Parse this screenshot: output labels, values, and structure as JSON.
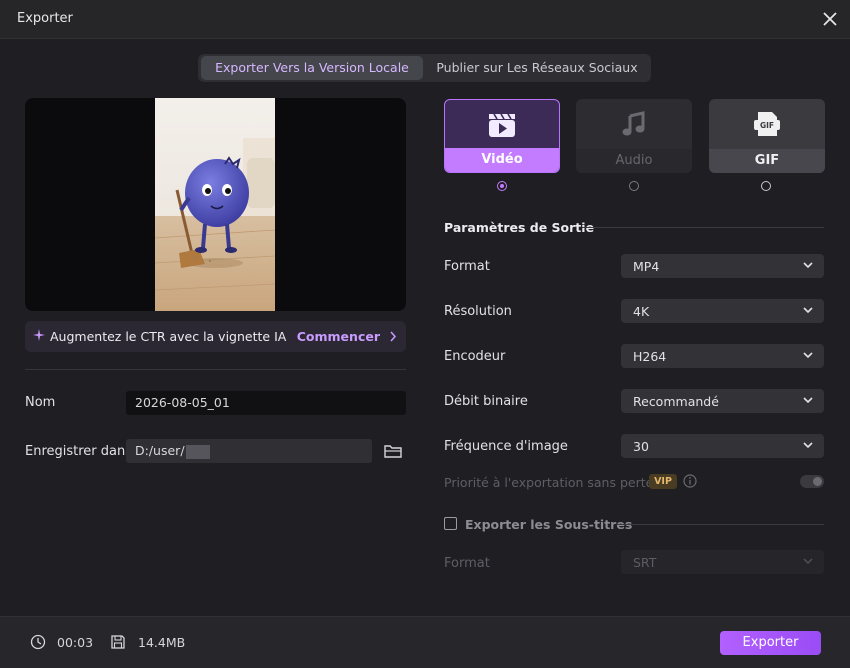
{
  "window": {
    "title": "Exporter"
  },
  "tabs": [
    {
      "label": "Exporter Vers la Version Locale",
      "active": true
    },
    {
      "label": "Publier sur Les Réseaux Sociaux",
      "active": false
    }
  ],
  "banner": {
    "text": "Augmentez le CTR avec la vignette IA",
    "action": "Commencer"
  },
  "file": {
    "name_label": "Nom",
    "name_value": "2026-08-05_01",
    "save_label": "Enregistrer dans",
    "save_path": "D:/user/"
  },
  "types": [
    {
      "label": "Vidéo",
      "icon": "video-clapper-icon",
      "selected": true
    },
    {
      "label": "Audio",
      "icon": "music-note-icon",
      "selected": false
    },
    {
      "label": "GIF",
      "icon": "gif-file-icon",
      "selected": false
    }
  ],
  "output": {
    "title": "Paramètres de Sortie",
    "rows": [
      {
        "label": "Format",
        "value": "MP4"
      },
      {
        "label": "Résolution",
        "value": "4K"
      },
      {
        "label": "Encodeur",
        "value": "H264"
      },
      {
        "label": "Débit binaire",
        "value": "Recommandé"
      },
      {
        "label": "Fréquence d'image",
        "value": "30"
      }
    ],
    "lossless_label": "Priorité à l'exportation sans perte",
    "vip_badge": "VIP",
    "lossless_enabled": false
  },
  "subtitles": {
    "label": "Exporter les Sous-titres",
    "checked": false,
    "format_label": "Format",
    "format_value": "SRT"
  },
  "footer": {
    "duration": "00:03",
    "size": "14.4MB",
    "export_label": "Exporter"
  },
  "colors": {
    "accent": "#c37bff",
    "background": "#1f1f23"
  }
}
